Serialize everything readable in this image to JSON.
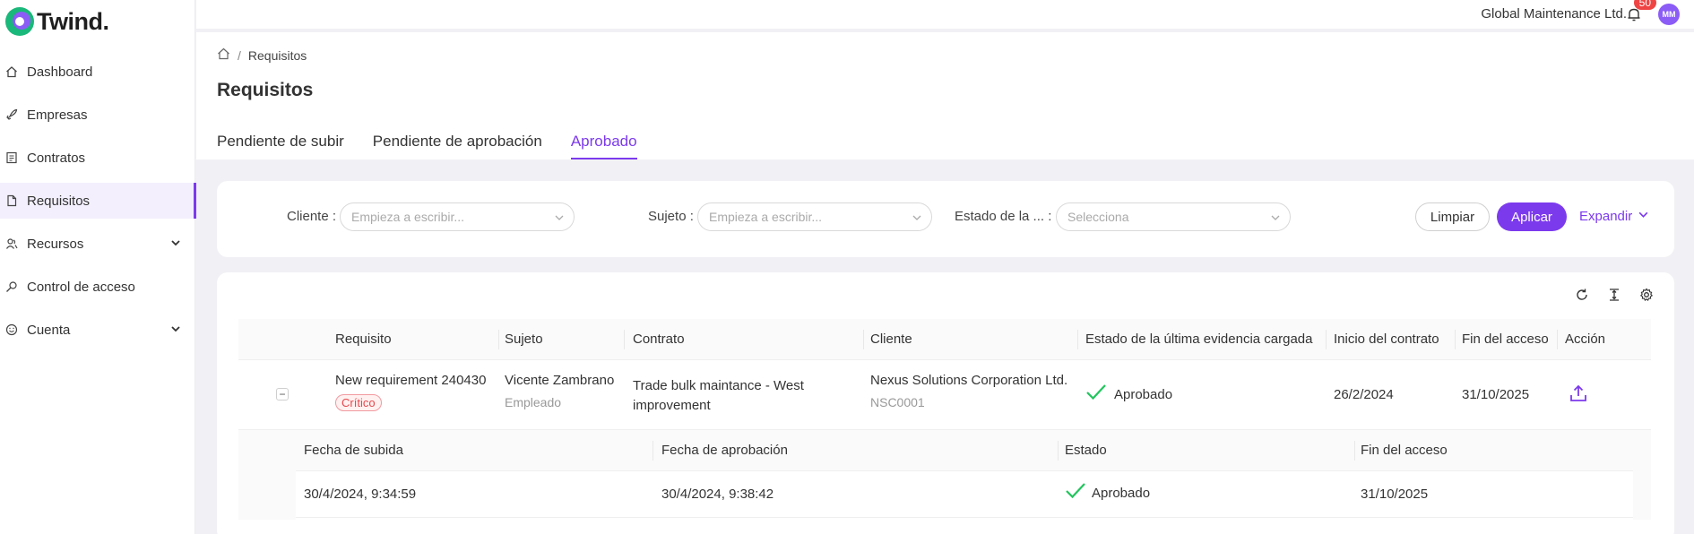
{
  "app": {
    "logo_text": "Twind."
  },
  "sidebar": {
    "items": [
      {
        "label": "Dashboard",
        "icon": "home-icon"
      },
      {
        "label": "Empresas",
        "icon": "rocket-icon"
      },
      {
        "label": "Contratos",
        "icon": "contract-icon"
      },
      {
        "label": "Requisitos",
        "icon": "document-icon",
        "active": true
      },
      {
        "label": "Recursos",
        "icon": "people-icon",
        "expandable": true
      },
      {
        "label": "Control de acceso",
        "icon": "key-icon"
      },
      {
        "label": "Cuenta",
        "icon": "smile-icon",
        "expandable": true
      }
    ]
  },
  "topbar": {
    "company": "Global Maintenance Ltd.",
    "notifications_count": "50",
    "avatar_initials": "MM"
  },
  "header": {
    "breadcrumb": "Requisitos",
    "title": "Requisitos",
    "tabs": [
      "Pendiente de subir",
      "Pendiente de aprobación",
      "Aprobado"
    ],
    "active_tab": "Aprobado"
  },
  "filters": {
    "cliente_label": "Cliente",
    "cliente_placeholder": "Empieza a escribir...",
    "sujeto_label": "Sujeto",
    "sujeto_placeholder": "Empieza a escribir...",
    "estado_label": "Estado de la ...",
    "estado_placeholder": "Selecciona",
    "clear_label": "Limpiar",
    "apply_label": "Aplicar",
    "expand_label": "Expandir"
  },
  "table": {
    "columns": [
      "Requisito",
      "Sujeto",
      "Contrato",
      "Cliente",
      "Estado de la última evidencia cargada",
      "Inicio del contrato",
      "Fin del acceso",
      "Acción"
    ],
    "rows": [
      {
        "requisito": "New requirement 240430",
        "tag": "Crítico",
        "sujeto": "Vicente Zambrano",
        "sujeto_role": "Empleado",
        "contrato_line1": "Trade bulk maintance - West",
        "contrato_line2": "improvement",
        "cliente": "Nexus Solutions Corporation Ltd.",
        "cliente_code": "NSC0001",
        "estado": "Aprobado",
        "inicio": "26/2/2024",
        "fin": "31/10/2025"
      }
    ]
  },
  "subtable": {
    "columns": [
      "Fecha de subida",
      "Fecha de aprobación",
      "Estado",
      "Fin del acceso"
    ],
    "rows": [
      {
        "subida": "30/4/2024, 9:34:59",
        "aprobacion": "30/4/2024, 9:38:42",
        "estado": "Aprobado",
        "fin": "31/10/2025"
      }
    ]
  },
  "colors": {
    "accent": "#7c3aed",
    "success": "#22c55e",
    "danger": "#e5484d"
  }
}
